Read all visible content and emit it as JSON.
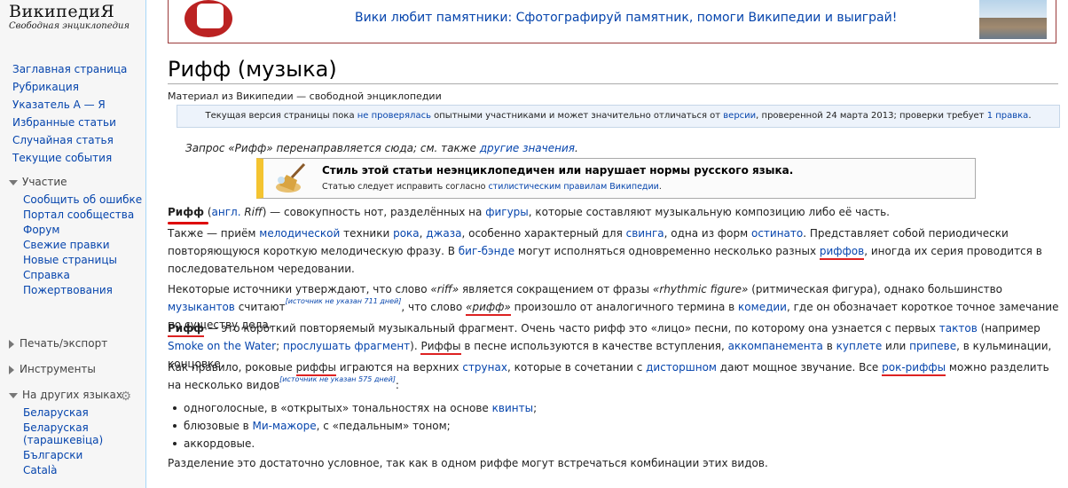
{
  "logo": {
    "title": "ВикипедиЯ",
    "subtitle": "Свободная энциклопедия"
  },
  "nav": [
    "Заглавная страница",
    "Рубрикация",
    "Указатель А — Я",
    "Избранные статьи",
    "Случайная статья",
    "Текущие события"
  ],
  "participation": {
    "head": "Участие",
    "items": [
      "Сообщить об ошибке",
      "Портал сообщества",
      "Форум",
      "Свежие правки",
      "Новые страницы",
      "Справка",
      "Пожертвования"
    ]
  },
  "print_export": "Печать/экспорт",
  "tools": "Инструменты",
  "languages": {
    "head": "На других языках",
    "items": [
      "Беларуская",
      "Беларуская (тарашкевіца)",
      "Български",
      "Català"
    ]
  },
  "banner": {
    "text": "Вики любит памятники: Сфотографируй памятник, помоги Википедии и выиграй!"
  },
  "title": "Рифф (музыка)",
  "sitesub": "Материал из Википедии — свободной энциклопедии",
  "flagged": {
    "t1": "Текущая версия страницы пока ",
    "l1": "не проверялась",
    "t2": " опытными участниками и может значительно отличаться от ",
    "l2": "версии",
    "t3": ", проверенной 24 марта 2013; проверки требует ",
    "l3": "1 правка",
    "t4": "."
  },
  "hatnote": {
    "text": "Запрос «Рифф» перенаправляется сюда; см. также ",
    "link": "другие значения",
    "end": "."
  },
  "ambox": {
    "title": "Стиль этой статьи неэнциклопедичен или нарушает нормы русского языка.",
    "text": "Статью следует исправить согласно ",
    "link": "стилистическим правилам Википедии",
    "end": "."
  },
  "p1": {
    "b": "Рифф",
    "t1": " (",
    "l1": "англ.",
    "t2": " ",
    "i1": "Riff",
    "t3": ") — совокупность нот, разделённых на ",
    "l2": "фигуры",
    "t4": ", которые составляют музыкальную композицию либо её часть."
  },
  "p2": {
    "t1": "Также — приём ",
    "l1": "мелодической",
    "t2": " техники ",
    "l2": "рока",
    "t3": ", ",
    "l3": "джаза",
    "t4": ", особенно характерный для ",
    "l4": "свинга",
    "t5": ", одна из форм ",
    "l5": "остинато",
    "t6": ". Представляет собой периодически повторяющуюся короткую мелодическую фразу. В ",
    "l6": "биг-бэнде",
    "t7": " могут исполняться одновременно несколько разных ",
    "l7": "риффов",
    "t8": ", иногда их серия проводится в последовательном чередовании."
  },
  "p3": {
    "t1": "Некоторые источники утверждают, что слово ",
    "i1": "«riff»",
    "t2": " является сокращением от фразы ",
    "i2": "«rhythmic figure»",
    "t3": " (ритмическая фигура), однако большинство ",
    "l1": "музыкантов",
    "t4": " считают",
    "cn": "[источник не указан 711 дней]",
    "t5": ", что слово ",
    "i3": "«рифф»",
    "t6": " произошло от аналогичного термина в ",
    "l2": "комедии",
    "t7": ", где он обозначает короткое точное замечание по существу дела."
  },
  "p4": {
    "b": "Рифф",
    "t1": " — это короткий повторяемый музыкальный фрагмент. Очень часто рифф это «лицо» песни, по которому она узнается с первых ",
    "l1": "тактов",
    "t2": " (например ",
    "l2": "Smoke on the Water",
    "t3": "; ",
    "l3": "прослушать фрагмент",
    "t4": "). ",
    "u1": "Риффы",
    "t5": " в песне используются в качестве вступления, ",
    "l4": "аккомпанемента",
    "t6": " в ",
    "l5": "куплете",
    "t7": " или ",
    "l6": "припеве",
    "t8": ", в кульминации, концовке."
  },
  "p5": {
    "t1": "Как правило, роковые ",
    "u1": "риффы",
    "t2": " играются на верхних ",
    "l1": "струнах",
    "t3": ", которые в сочетании с ",
    "l2": "дисторшном",
    "t4": " дают мощное звучание. Все ",
    "l3": "рок-риффы",
    "t5": " можно разделить на несколько видов",
    "cn": "[источник не указан 575 дней]",
    "t6": ":"
  },
  "list": {
    "a1": "одноголосные, в «открытых» тональностях на основе ",
    "al": "квинты",
    "a2": ";",
    "b1": "блюзовые в ",
    "bl": "Ми-мажоре",
    "b2": ", с «педальным» тоном;",
    "c": "аккордовые."
  },
  "p6": "Разделение это достаточно условное, так как в одном риффе могут встречаться комбинации этих видов."
}
